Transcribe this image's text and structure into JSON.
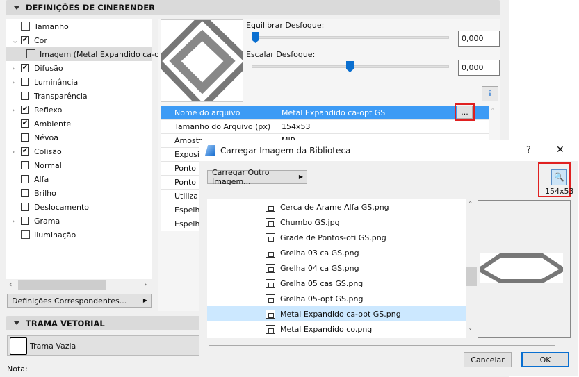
{
  "panel": {
    "title": "DEFINIÇÕES DE CINERENDER",
    "tree": [
      {
        "label": "Tamanho",
        "type": "icon",
        "icon": "size-icon"
      },
      {
        "label": "Cor",
        "checked": true,
        "expanded": true
      },
      {
        "label": "Imagem (Metal Expandido ca-opt GS)",
        "type": "icon",
        "icon": "image-icon",
        "selected": true
      },
      {
        "label": "Difusão",
        "checked": true,
        "expandable": true
      },
      {
        "label": "Luminância",
        "checked": false,
        "expandable": true
      },
      {
        "label": "Transparência",
        "checked": false
      },
      {
        "label": "Reflexo",
        "checked": true,
        "expandable": true
      },
      {
        "label": "Ambiente",
        "checked": true
      },
      {
        "label": "Névoa",
        "checked": false
      },
      {
        "label": "Colisão",
        "checked": true,
        "expandable": true
      },
      {
        "label": "Normal",
        "checked": false
      },
      {
        "label": "Alfa",
        "checked": false
      },
      {
        "label": "Brilho",
        "checked": false
      },
      {
        "label": "Deslocamento",
        "checked": false
      },
      {
        "label": "Grama",
        "checked": false,
        "expandable": true
      },
      {
        "label": "Iluminação",
        "type": "icon",
        "icon": "lightbulb-icon"
      }
    ],
    "match_button": "Definições Correspondentes...",
    "sliders": [
      {
        "label": "Equilibrar Desfoque:",
        "value": "0,000",
        "level": 0
      },
      {
        "label": "Escalar Desfoque:",
        "value": "0,000",
        "level": 0.5
      }
    ],
    "props": [
      {
        "name": "Nome do arquivo",
        "value": "Metal Expandido ca-opt GS",
        "selected": true
      },
      {
        "name": "Tamanho do Arquivo (px)",
        "value": "154x53"
      },
      {
        "name": "Amostr",
        "value": "MIP"
      },
      {
        "name": "Exposi",
        "value": ""
      },
      {
        "name": "Ponto",
        "value": ""
      },
      {
        "name": "Ponto",
        "value": ""
      },
      {
        "name": "Utilizar",
        "value": ""
      },
      {
        "name": "Espelh",
        "value": ""
      },
      {
        "name": "Espelh",
        "value": ""
      }
    ],
    "browse_label": "...",
    "trama": {
      "title": "TRAMA VETORIAL",
      "value": "Trama Vazia"
    },
    "note": "Nota:"
  },
  "dialog": {
    "title": "Carregar Imagem da Biblioteca",
    "help": "?",
    "close": "✕",
    "load_other": "Carregar Outro Imagem...",
    "size": "154x53",
    "files": [
      "Cerca de Arame Alfa GS.png",
      "Chumbo GS.jpg",
      "Grade de Pontos-oti GS.png",
      "Grelha 03 ca GS.png",
      "Grelha 04 ca GS.png",
      "Grelha 05 cas GS.png",
      "Grelha 05-opt GS.png",
      "Metal Expandido ca-opt GS.png",
      "Metal Expandido co.png"
    ],
    "selected_index": 7,
    "cancel": "Cancelar",
    "ok": "OK"
  },
  "colors": {
    "accent": "#3d9bf5",
    "highlight": "#cce8ff",
    "callout": "#e02020"
  }
}
